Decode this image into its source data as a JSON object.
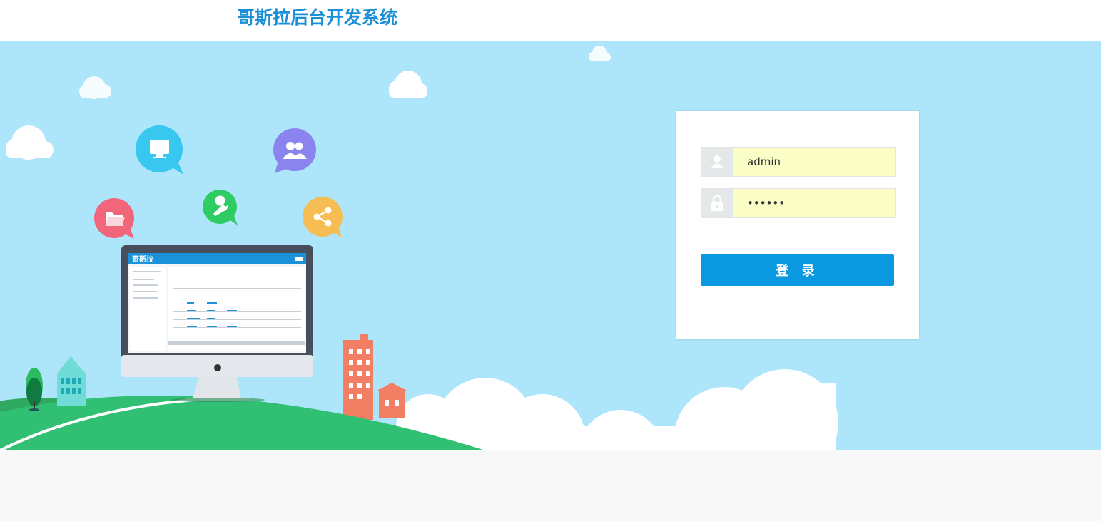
{
  "header": {
    "title": "哥斯拉后台开发系统"
  },
  "login": {
    "username_value": "admin",
    "password_value": "••••••",
    "submit_label": "登 录"
  },
  "monitor": {
    "brand": "哥斯拉"
  },
  "icons": {
    "user": "user-icon",
    "lock": "lock-icon",
    "screen": "monitor-bubble-icon",
    "people": "users-bubble-icon",
    "folder": "folder-bubble-icon",
    "tool": "wrench-bubble-icon",
    "share": "share-bubble-icon"
  },
  "colors": {
    "title": "#1a8fd8",
    "sky": "#ade5fb",
    "button": "#0a98e0",
    "input_fill": "#fafdc6",
    "hill": "#31c073"
  }
}
